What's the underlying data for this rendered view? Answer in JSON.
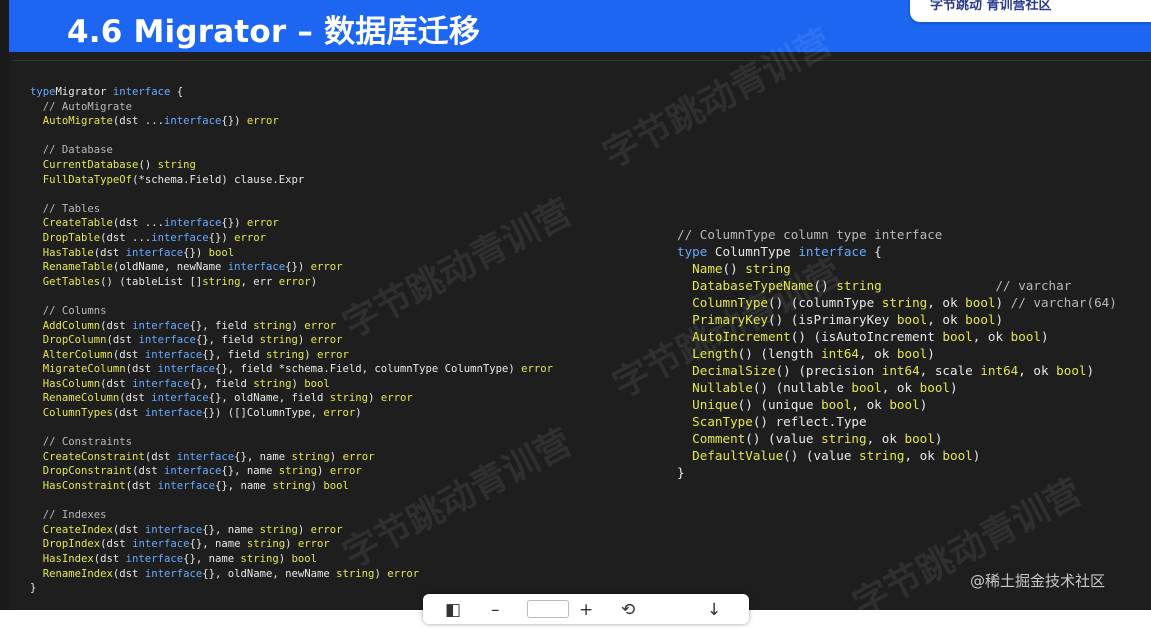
{
  "slide": {
    "title": "4.6 Migrator – 数据库迁移",
    "brand": "字节跳动  青训营社区",
    "site_watermark": "@稀土掘金技术社区",
    "bg_watermark": "字节跳动青训营"
  },
  "code_left": [
    [
      [
        "k",
        "type"
      ],
      [
        "",
        "Migrator "
      ],
      [
        "k",
        "interface"
      ],
      [
        "",
        " {"
      ]
    ],
    [
      [
        "c",
        "  // AutoMigrate"
      ]
    ],
    [
      [
        "f",
        "  AutoMigrate"
      ],
      [
        "",
        "(dst ..."
      ],
      [
        "k",
        "interface"
      ],
      [
        "",
        "{}) "
      ],
      [
        "t",
        "error"
      ]
    ],
    [],
    [
      [
        "c",
        "  // Database"
      ]
    ],
    [
      [
        "f",
        "  CurrentDatabase"
      ],
      [
        "",
        "() "
      ],
      [
        "t",
        "string"
      ]
    ],
    [
      [
        "f",
        "  FullDataTypeOf"
      ],
      [
        "",
        "(*schema.Field) clause.Expr"
      ]
    ],
    [],
    [
      [
        "c",
        "  // Tables"
      ]
    ],
    [
      [
        "f",
        "  CreateTable"
      ],
      [
        "",
        "(dst ..."
      ],
      [
        "k",
        "interface"
      ],
      [
        "",
        "{}) "
      ],
      [
        "t",
        "error"
      ]
    ],
    [
      [
        "f",
        "  DropTable"
      ],
      [
        "",
        "(dst ..."
      ],
      [
        "k",
        "interface"
      ],
      [
        "",
        "{}) "
      ],
      [
        "t",
        "error"
      ]
    ],
    [
      [
        "f",
        "  HasTable"
      ],
      [
        "",
        "(dst "
      ],
      [
        "k",
        "interface"
      ],
      [
        "",
        "{}) "
      ],
      [
        "t",
        "bool"
      ]
    ],
    [
      [
        "f",
        "  RenameTable"
      ],
      [
        "",
        "(oldName, newName "
      ],
      [
        "k",
        "interface"
      ],
      [
        "",
        "{}) "
      ],
      [
        "t",
        "error"
      ]
    ],
    [
      [
        "f",
        "  GetTables"
      ],
      [
        "",
        "() (tableList []"
      ],
      [
        "t",
        "string"
      ],
      [
        "",
        ", err "
      ],
      [
        "t",
        "error"
      ],
      [
        "",
        ")"
      ]
    ],
    [],
    [
      [
        "c",
        "  // Columns"
      ]
    ],
    [
      [
        "f",
        "  AddColumn"
      ],
      [
        "",
        "(dst "
      ],
      [
        "k",
        "interface"
      ],
      [
        "",
        "{}, field "
      ],
      [
        "t",
        "string"
      ],
      [
        "",
        ") "
      ],
      [
        "t",
        "error"
      ]
    ],
    [
      [
        "f",
        "  DropColumn"
      ],
      [
        "",
        "(dst "
      ],
      [
        "k",
        "interface"
      ],
      [
        "",
        "{}, field "
      ],
      [
        "t",
        "string"
      ],
      [
        "",
        ") "
      ],
      [
        "t",
        "error"
      ]
    ],
    [
      [
        "f",
        "  AlterColumn"
      ],
      [
        "",
        "(dst "
      ],
      [
        "k",
        "interface"
      ],
      [
        "",
        "{}, field "
      ],
      [
        "t",
        "string"
      ],
      [
        "",
        ") "
      ],
      [
        "t",
        "error"
      ]
    ],
    [
      [
        "f",
        "  MigrateColumn"
      ],
      [
        "",
        "(dst "
      ],
      [
        "k",
        "interface"
      ],
      [
        "",
        "{}, field *schema.Field, columnType ColumnType) "
      ],
      [
        "t",
        "error"
      ]
    ],
    [
      [
        "f",
        "  HasColumn"
      ],
      [
        "",
        "(dst "
      ],
      [
        "k",
        "interface"
      ],
      [
        "",
        "{}, field "
      ],
      [
        "t",
        "string"
      ],
      [
        "",
        ") "
      ],
      [
        "t",
        "bool"
      ]
    ],
    [
      [
        "f",
        "  RenameColumn"
      ],
      [
        "",
        "(dst "
      ],
      [
        "k",
        "interface"
      ],
      [
        "",
        "{}, oldName, field "
      ],
      [
        "t",
        "string"
      ],
      [
        "",
        ") "
      ],
      [
        "t",
        "error"
      ]
    ],
    [
      [
        "f",
        "  ColumnTypes"
      ],
      [
        "",
        "(dst "
      ],
      [
        "k",
        "interface"
      ],
      [
        "",
        "{}) ([]ColumnType, "
      ],
      [
        "t",
        "error"
      ],
      [
        "",
        ")"
      ]
    ],
    [],
    [
      [
        "c",
        "  // Constraints"
      ]
    ],
    [
      [
        "f",
        "  CreateConstraint"
      ],
      [
        "",
        "(dst "
      ],
      [
        "k",
        "interface"
      ],
      [
        "",
        "{}, name "
      ],
      [
        "t",
        "string"
      ],
      [
        "",
        ") "
      ],
      [
        "t",
        "error"
      ]
    ],
    [
      [
        "f",
        "  DropConstraint"
      ],
      [
        "",
        "(dst "
      ],
      [
        "k",
        "interface"
      ],
      [
        "",
        "{}, name "
      ],
      [
        "t",
        "string"
      ],
      [
        "",
        ") "
      ],
      [
        "t",
        "error"
      ]
    ],
    [
      [
        "f",
        "  HasConstraint"
      ],
      [
        "",
        "(dst "
      ],
      [
        "k",
        "interface"
      ],
      [
        "",
        "{}, name "
      ],
      [
        "t",
        "string"
      ],
      [
        "",
        ") "
      ],
      [
        "t",
        "bool"
      ]
    ],
    [],
    [
      [
        "c",
        "  // Indexes"
      ]
    ],
    [
      [
        "f",
        "  CreateIndex"
      ],
      [
        "",
        "(dst "
      ],
      [
        "k",
        "interface"
      ],
      [
        "",
        "{}, name "
      ],
      [
        "t",
        "string"
      ],
      [
        "",
        ") "
      ],
      [
        "t",
        "error"
      ]
    ],
    [
      [
        "f",
        "  DropIndex"
      ],
      [
        "",
        "(dst "
      ],
      [
        "k",
        "interface"
      ],
      [
        "",
        "{}, name "
      ],
      [
        "t",
        "string"
      ],
      [
        "",
        ") "
      ],
      [
        "t",
        "error"
      ]
    ],
    [
      [
        "f",
        "  HasIndex"
      ],
      [
        "",
        "(dst "
      ],
      [
        "k",
        "interface"
      ],
      [
        "",
        "{}, name "
      ],
      [
        "t",
        "string"
      ],
      [
        "",
        ") "
      ],
      [
        "t",
        "bool"
      ]
    ],
    [
      [
        "f",
        "  RenameIndex"
      ],
      [
        "",
        "(dst "
      ],
      [
        "k",
        "interface"
      ],
      [
        "",
        "{}, oldName, newName "
      ],
      [
        "t",
        "string"
      ],
      [
        "",
        ") "
      ],
      [
        "t",
        "error"
      ]
    ],
    [
      [
        "",
        "}"
      ]
    ]
  ],
  "code_right": [
    [
      [
        "c",
        "// ColumnType column type interface"
      ]
    ],
    [
      [
        "k",
        "type"
      ],
      [
        "",
        " ColumnType "
      ],
      [
        "k",
        "interface"
      ],
      [
        "",
        " {"
      ]
    ],
    [
      [
        "f",
        "  Name"
      ],
      [
        "",
        "() "
      ],
      [
        "t",
        "string"
      ]
    ],
    [
      [
        "f",
        "  DatabaseTypeName"
      ],
      [
        "",
        "() "
      ],
      [
        "t",
        "string"
      ],
      [
        "",
        "               "
      ],
      [
        "c",
        "// varchar"
      ]
    ],
    [
      [
        "f",
        "  ColumnType"
      ],
      [
        "",
        "() (columnType "
      ],
      [
        "t",
        "string"
      ],
      [
        "",
        ", ok "
      ],
      [
        "t",
        "bool"
      ],
      [
        "",
        ") "
      ],
      [
        "c",
        "// varchar(64)"
      ]
    ],
    [
      [
        "f",
        "  PrimaryKey"
      ],
      [
        "",
        "() (isPrimaryKey "
      ],
      [
        "t",
        "bool"
      ],
      [
        "",
        ", ok "
      ],
      [
        "t",
        "bool"
      ],
      [
        "",
        ")"
      ]
    ],
    [
      [
        "f",
        "  AutoIncrement"
      ],
      [
        "",
        "() (isAutoIncrement "
      ],
      [
        "t",
        "bool"
      ],
      [
        "",
        ", ok "
      ],
      [
        "t",
        "bool"
      ],
      [
        "",
        ")"
      ]
    ],
    [
      [
        "f",
        "  Length"
      ],
      [
        "",
        "() (length "
      ],
      [
        "t",
        "int64"
      ],
      [
        "",
        ", ok "
      ],
      [
        "t",
        "bool"
      ],
      [
        "",
        ")"
      ]
    ],
    [
      [
        "f",
        "  DecimalSize"
      ],
      [
        "",
        "() (precision "
      ],
      [
        "t",
        "int64"
      ],
      [
        "",
        ", scale "
      ],
      [
        "t",
        "int64"
      ],
      [
        "",
        ", ok "
      ],
      [
        "t",
        "bool"
      ],
      [
        "",
        ")"
      ]
    ],
    [
      [
        "f",
        "  Nullable"
      ],
      [
        "",
        "() (nullable "
      ],
      [
        "t",
        "bool"
      ],
      [
        "",
        ", ok "
      ],
      [
        "t",
        "bool"
      ],
      [
        "",
        ")"
      ]
    ],
    [
      [
        "f",
        "  Unique"
      ],
      [
        "",
        "() (unique "
      ],
      [
        "t",
        "bool"
      ],
      [
        "",
        ", ok "
      ],
      [
        "t",
        "bool"
      ],
      [
        "",
        ")"
      ]
    ],
    [
      [
        "f",
        "  ScanType"
      ],
      [
        "",
        "() reflect.Type"
      ]
    ],
    [
      [
        "f",
        "  Comment"
      ],
      [
        "",
        "() (value "
      ],
      [
        "t",
        "string"
      ],
      [
        "",
        ", ok "
      ],
      [
        "t",
        "bool"
      ],
      [
        "",
        ")"
      ]
    ],
    [
      [
        "f",
        "  DefaultValue"
      ],
      [
        "",
        "() (value "
      ],
      [
        "t",
        "string"
      ],
      [
        "",
        ", ok "
      ],
      [
        "t",
        "bool"
      ],
      [
        "",
        ")"
      ]
    ],
    [
      [
        "",
        "}"
      ]
    ]
  ],
  "toolbar": {
    "buttons": [
      "◧",
      "–",
      "□",
      "+",
      "⟲",
      "↓"
    ]
  }
}
